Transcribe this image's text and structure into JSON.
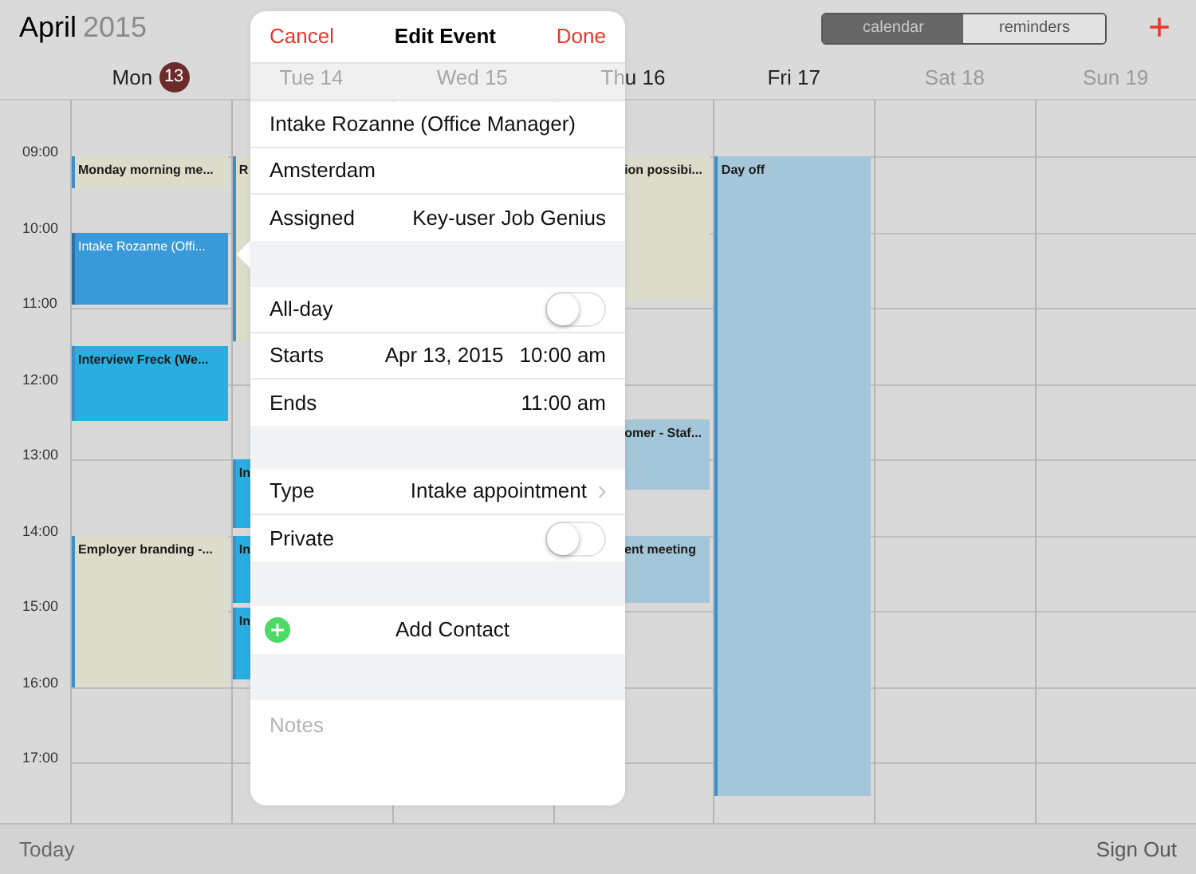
{
  "header": {
    "month": "April",
    "year": "2015",
    "segments": [
      {
        "label": "calendar",
        "selected": true
      },
      {
        "label": "reminders",
        "selected": false
      }
    ],
    "add_button": "+"
  },
  "days": [
    {
      "label": "Mon",
      "badge": "13",
      "dimmed": false
    },
    {
      "label": "Tue 14",
      "dimmed": false
    },
    {
      "label": "Wed 15",
      "dimmed": false
    },
    {
      "label": "Thu 16",
      "dimmed": false
    },
    {
      "label": "Fri 17",
      "dimmed": false
    },
    {
      "label": "Sat 18",
      "dimmed": true
    },
    {
      "label": "Sun 19",
      "dimmed": true
    }
  ],
  "times": [
    "09:00",
    "10:00",
    "11:00",
    "12:00",
    "13:00",
    "14:00",
    "15:00",
    "16:00",
    "17:00"
  ],
  "columns": [
    {
      "events": [
        {
          "title": "Monday morning me...",
          "color": "#dcdccb",
          "selected": false
        },
        {
          "title": "Intake Rozanne (Offi...",
          "color": "#3a9ad9",
          "selected": true
        },
        {
          "title": "Interview Freck (We...",
          "color": "#2aaee0",
          "selected": false
        },
        {
          "title": "Employer branding -...",
          "color": "#dcdccb",
          "selected": false
        }
      ]
    },
    {
      "events": [
        {
          "title": "R",
          "color": "#dcdccb",
          "selected": false
        },
        {
          "title": "In",
          "color": "#2aaee0",
          "selected": false
        },
        {
          "title": "In",
          "color": "#2aaee0",
          "selected": false
        },
        {
          "title": "In",
          "color": "#2aaee0",
          "selected": false
        }
      ]
    },
    {},
    {
      "events": [
        {
          "title": "ion possibi...",
          "color": "#dcdccb",
          "selected": false
        },
        {
          "title": "omer - Staf...",
          "color": "#a3c6d8",
          "selected": false
        },
        {
          "title": "ent meeting",
          "color": "#a3c6d8",
          "selected": false
        }
      ]
    },
    {
      "events": [
        {
          "title": "Day off",
          "color": "#a3c6d8",
          "selected": false
        }
      ]
    },
    {},
    {}
  ],
  "popover": {
    "cancel": "Cancel",
    "title": "Edit Event",
    "done": "Done",
    "sections": [
      [
        {
          "kind": "field",
          "value": "Intake Rozanne (Office Manager)"
        },
        {
          "kind": "field",
          "value": "Amsterdam"
        },
        {
          "kind": "detail",
          "label": "Assigned",
          "value": "Key-user Job Genius"
        }
      ],
      [
        {
          "kind": "toggle",
          "label": "All-day",
          "on": false
        },
        {
          "kind": "detail",
          "label": "Starts",
          "date": "Apr 13, 2015",
          "value": "10:00 am"
        },
        {
          "kind": "detail",
          "label": "Ends",
          "value": "11:00 am"
        }
      ],
      [
        {
          "kind": "link",
          "label": "Type",
          "value": "Intake appointment"
        },
        {
          "kind": "toggle",
          "label": "Private",
          "on": false
        }
      ],
      [
        {
          "kind": "add",
          "label": "Add Contact"
        }
      ],
      [
        {
          "kind": "notes",
          "placeholder": "Notes"
        }
      ]
    ]
  },
  "footer": {
    "today": "Today",
    "sign_out": "Sign Out"
  }
}
